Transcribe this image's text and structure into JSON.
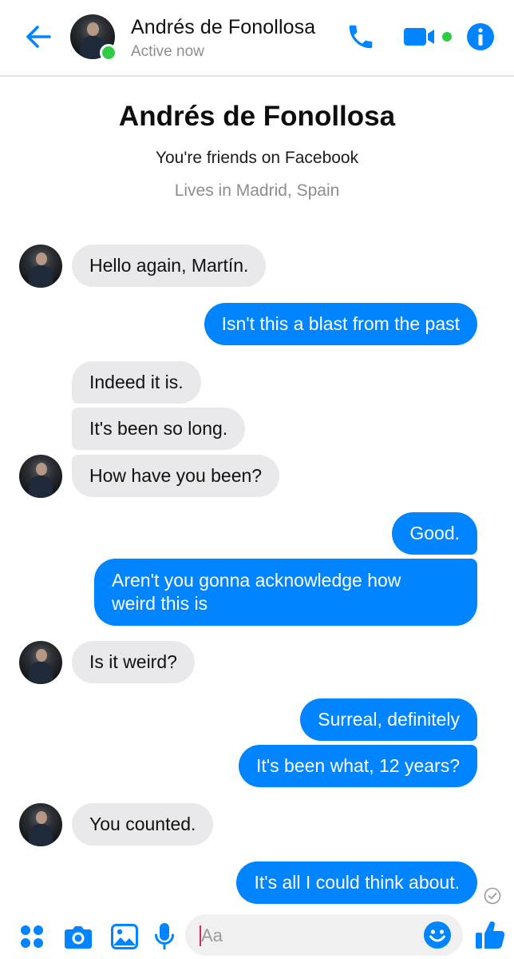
{
  "header": {
    "name": "Andrés de Fonollosa",
    "status": "Active now"
  },
  "intro": {
    "name": "Andrés de Fonollosa",
    "friends_text": "You're friends on Facebook",
    "location": "Lives in Madrid, Spain"
  },
  "messages": [
    {
      "sender": "them",
      "text": "Hello again, Martín."
    },
    {
      "sender": "me",
      "text": "Isn't this a blast from the past"
    },
    {
      "sender": "them",
      "text": "Indeed it is."
    },
    {
      "sender": "them",
      "text": "It's been so long."
    },
    {
      "sender": "them",
      "text": "How have you been?"
    },
    {
      "sender": "me",
      "text": "Good."
    },
    {
      "sender": "me",
      "text": "Aren't you gonna acknowledge how",
      "text2": "weird this is"
    },
    {
      "sender": "them",
      "text": "Is it weird?"
    },
    {
      "sender": "me",
      "text": "Surreal, definitely"
    },
    {
      "sender": "me",
      "text": "It's been what, 12 years?"
    },
    {
      "sender": "them",
      "text": "You counted."
    },
    {
      "sender": "me",
      "text": "It's all I could think about."
    }
  ],
  "composer": {
    "placeholder": "Aa",
    "value": ""
  },
  "colors": {
    "accent": "#0084ff",
    "incoming_bubble": "#e9e9eb",
    "online": "#31cc46"
  },
  "icons": {
    "back": "arrow-left-icon",
    "call": "phone-icon",
    "video": "video-camera-icon",
    "info": "info-icon",
    "apps": "four-dots-icon",
    "camera": "camera-icon",
    "gallery": "image-icon",
    "mic": "microphone-icon",
    "emoji": "smiley-icon",
    "like": "thumbs-up-icon",
    "seen": "check-circle-icon"
  }
}
